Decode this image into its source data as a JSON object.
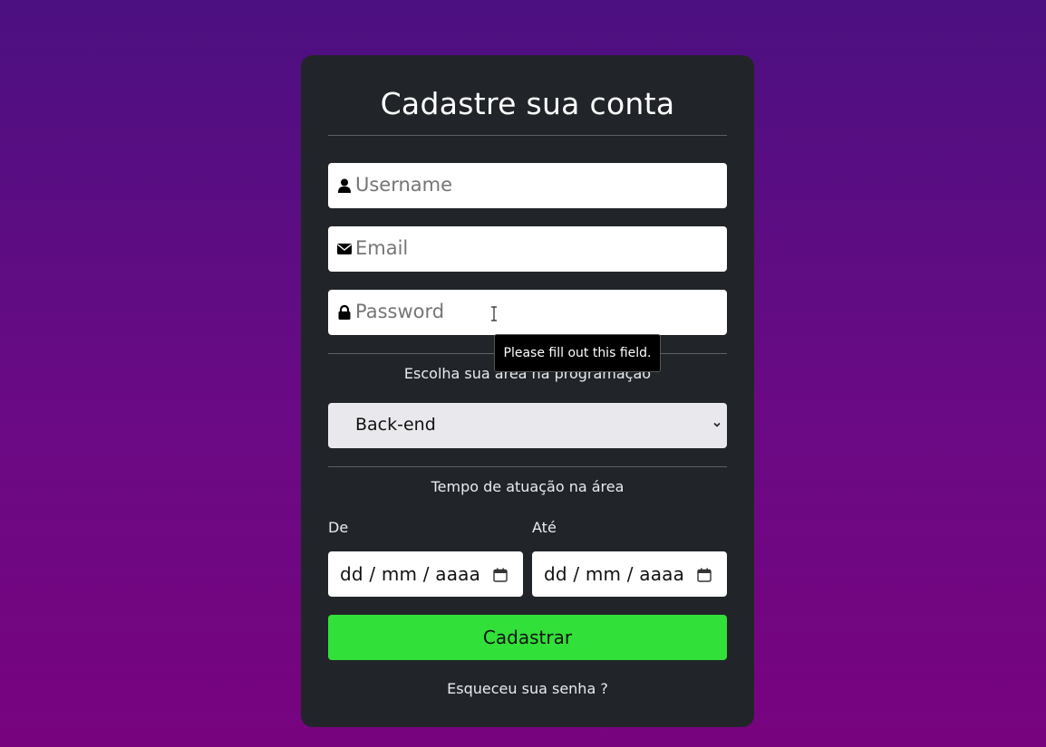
{
  "form": {
    "title": "Cadastre sua conta",
    "username_placeholder": "Username",
    "email_placeholder": "Email",
    "password_placeholder": "Password",
    "area_label": "Escolha sua área na programação",
    "area_selected": "Back-end",
    "time_label": "Tempo de atuação na área",
    "from_label": "De",
    "to_label": "Até",
    "date_format": "dd / mm / aaaa",
    "submit_label": "Cadastrar",
    "forgot_label": "Esqueceu sua senha ?"
  },
  "tooltip": {
    "text": "Please fill out this field."
  },
  "colors": {
    "background_top": "#4c1080",
    "background_bottom": "#78037f",
    "card": "#212529",
    "submit_button": "#32e03a",
    "select_background": "#e9e9ed"
  },
  "icons": {
    "username": "user-icon",
    "email": "envelope-icon",
    "password": "lock-icon",
    "date": "calendar-icon",
    "select": "chevron-down-icon"
  }
}
